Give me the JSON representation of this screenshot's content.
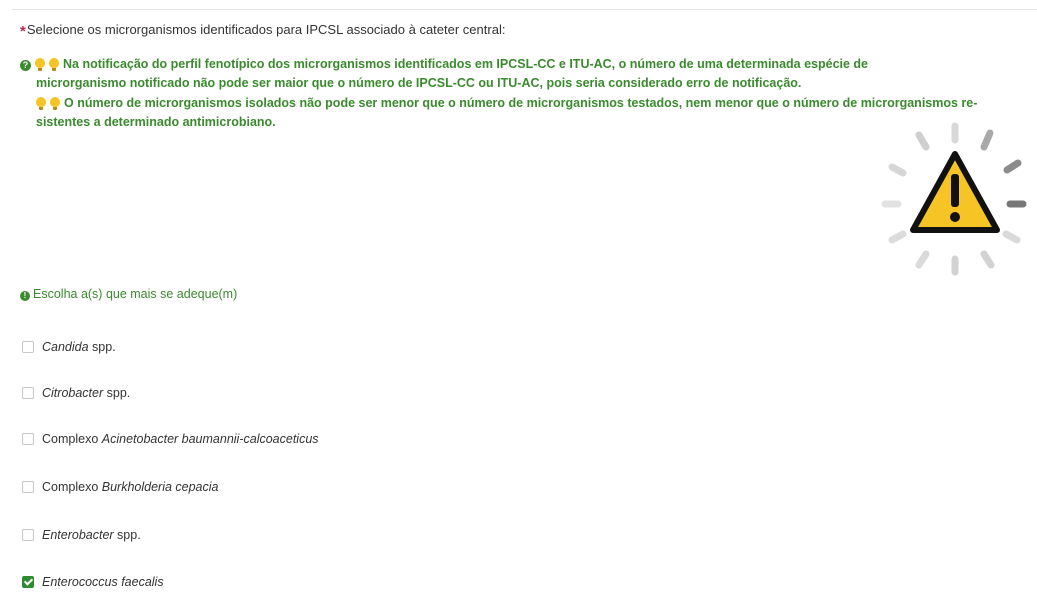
{
  "question": {
    "required_mark": "*",
    "text": "Selecione os microrganismos identificados para IPCSL associado à cateter central:"
  },
  "help": {
    "line1": "Na notificação do perfil fenotípico dos microrganismos identificados em IPCSL-CC e ITU-AC, o número de uma determinada espécie de",
    "line1_cont": "microrganismo notificado não pode ser maior que o número de IPCSL-CC ou ITU-AC, pois seria considerado erro de notificação.",
    "line2": "O número de microrganismos isolados não pode ser menor que o número de microrganismos testados, nem menor que o número de microrganismos re-",
    "line2_cont": "sistentes a determinado antimicrobiano."
  },
  "choose_hint": "Escolha a(s) que mais se adeque(m)",
  "options": [
    {
      "prefix": "",
      "italic": "Candida",
      "suffix": " spp.",
      "checked": false
    },
    {
      "prefix": "",
      "italic": "Citrobacter",
      "suffix": " spp.",
      "checked": false
    },
    {
      "prefix": "Complexo ",
      "italic": "Acinetobacter baumannii-calcoaceticus",
      "suffix": "",
      "checked": false
    },
    {
      "prefix": "Complexo ",
      "italic": "Burkholderia cepacia",
      "suffix": "",
      "checked": false
    },
    {
      "prefix": "",
      "italic": "Enterobacter",
      "suffix": " spp.",
      "checked": false
    },
    {
      "prefix": "",
      "italic": "Enterococcus faecalis",
      "suffix": "",
      "checked": true
    }
  ],
  "colors": {
    "help_green": "#3a8a2e",
    "check_green": "#2f8a34",
    "warning_yellow": "#f6c525",
    "required_red": "#c7254e"
  },
  "icons": {
    "help": "question-circle-icon",
    "tip": "lightbulb-icon",
    "hint": "exclamation-circle-icon",
    "warning": "warning-triangle-icon"
  }
}
